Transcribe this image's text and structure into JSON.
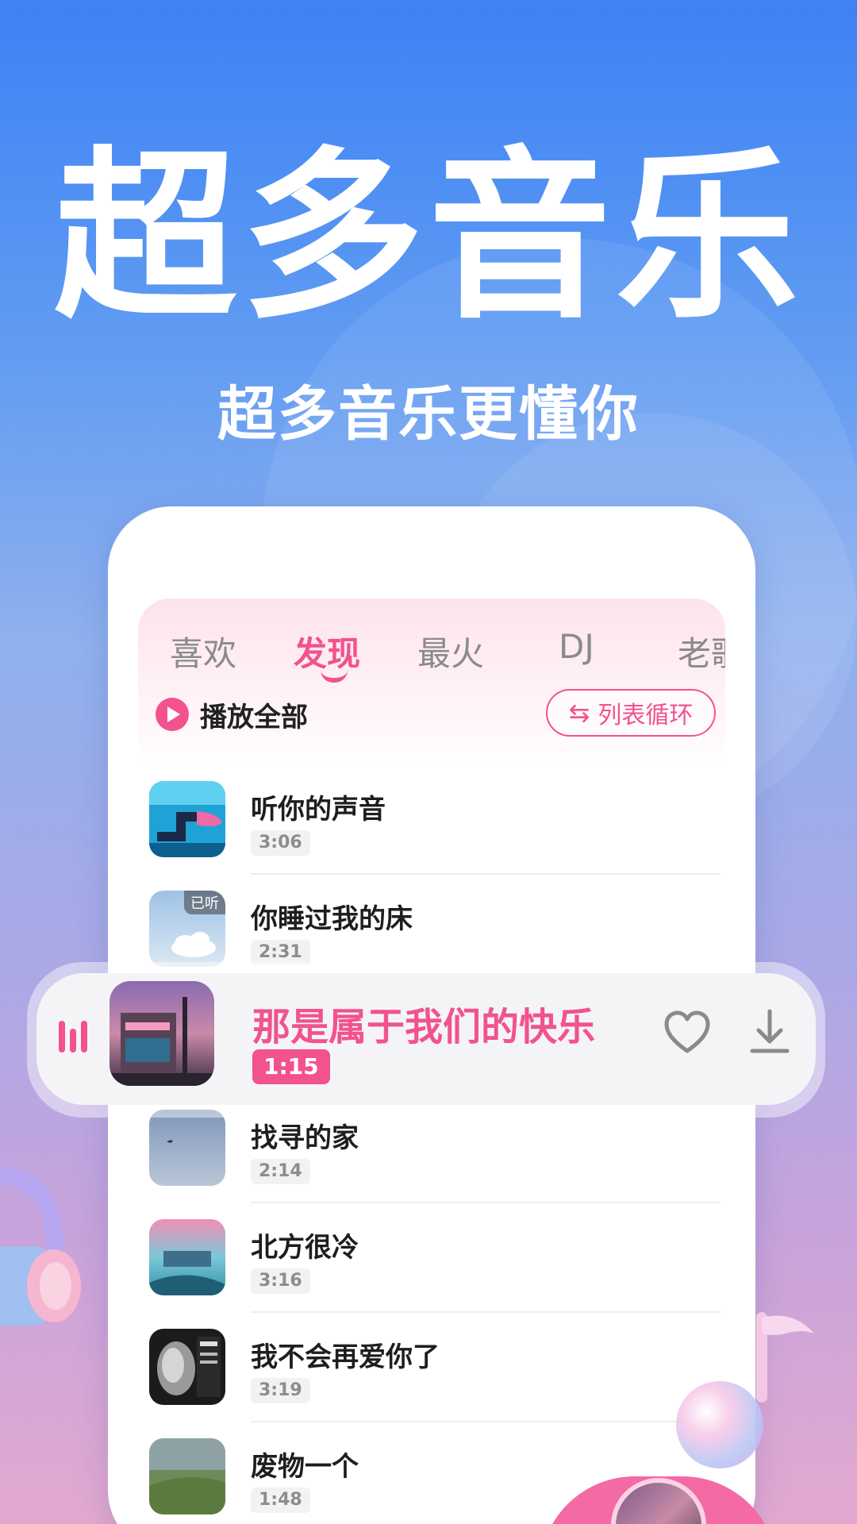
{
  "hero": {
    "title": "超多音乐",
    "subtitle": "超多音乐更懂你"
  },
  "tabs": [
    {
      "label": "喜欢",
      "active": false
    },
    {
      "label": "发现",
      "active": true
    },
    {
      "label": "最火",
      "active": false
    },
    {
      "label": "DJ",
      "active": false
    },
    {
      "label": "老歌",
      "active": false
    }
  ],
  "controls": {
    "play_all_label": "播放全部",
    "loop_label": "列表循环"
  },
  "songs": [
    {
      "name": "听你的声音",
      "duration": "3:06",
      "badge": ""
    },
    {
      "name": "你睡过我的床",
      "duration": "2:31",
      "badge": "已听"
    },
    {
      "name": "找寻的家",
      "duration": "2:14",
      "badge": ""
    },
    {
      "name": "北方很冷",
      "duration": "3:16",
      "badge": ""
    },
    {
      "name": "我不会再爱你了",
      "duration": "3:19",
      "badge": ""
    },
    {
      "name": "废物一个",
      "duration": "1:48",
      "badge": ""
    }
  ],
  "now_playing": {
    "title": "那是属于我们的快乐",
    "time": "1:15"
  },
  "colors": {
    "accent": "#f2528e",
    "background_top": "#3d82f5",
    "background_bottom": "#e3a9cf"
  },
  "icons": {
    "play_all": "play-circle-icon",
    "loop": "repeat-icon",
    "equalizer": "equalizer-icon",
    "favorite": "heart-icon",
    "download": "download-icon"
  }
}
